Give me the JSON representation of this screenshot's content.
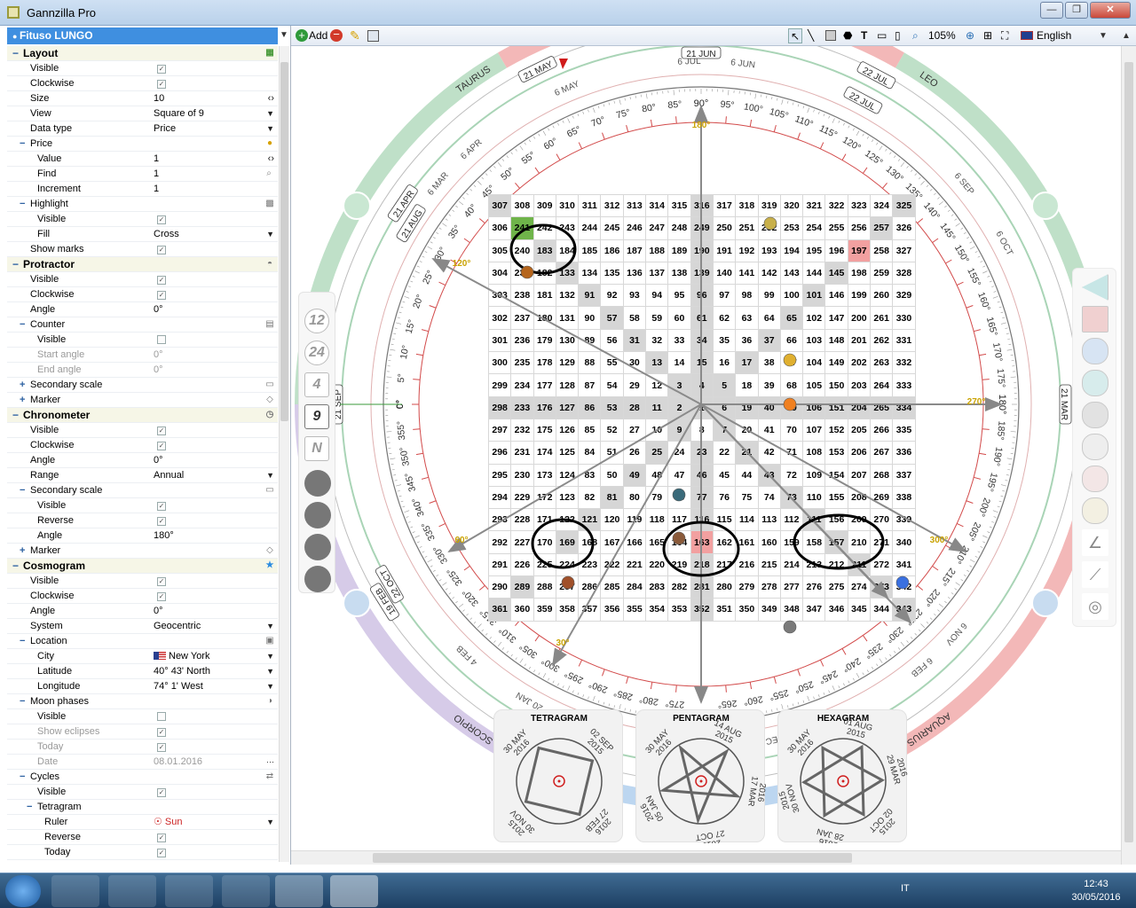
{
  "window": {
    "title": "Gannzilla Pro",
    "minimize": "—",
    "maximize": "❐",
    "close": "✕"
  },
  "profile": {
    "name": "Fituso LUNGO"
  },
  "properties": [
    {
      "kind": "cat",
      "label": "Layout",
      "toggle": "−",
      "icon": "grid-color-icon"
    },
    {
      "kind": "sub",
      "label": "Visible",
      "check": true
    },
    {
      "kind": "sub",
      "label": "Clockwise",
      "check": true
    },
    {
      "kind": "sub",
      "label": "Size",
      "value": "10",
      "spin": true
    },
    {
      "kind": "sub",
      "label": "View",
      "value": "Square of 9",
      "dd": true
    },
    {
      "kind": "sub",
      "label": "Data type",
      "value": "Price",
      "dd": true
    },
    {
      "kind": "sub",
      "label": "Price",
      "toggle": "−",
      "icon": "coin-icon"
    },
    {
      "kind": "sub2",
      "label": "Value",
      "value": "1",
      "spin": true
    },
    {
      "kind": "sub2",
      "label": "Find",
      "value": "1",
      "icon": "search-icon"
    },
    {
      "kind": "sub2",
      "label": "Increment",
      "value": "1"
    },
    {
      "kind": "sub",
      "label": "Highlight",
      "toggle": "−",
      "icon": "pattern-icon"
    },
    {
      "kind": "sub2",
      "label": "Visible",
      "check": true
    },
    {
      "kind": "sub2",
      "label": "Fill",
      "value": "Cross",
      "dd": true
    },
    {
      "kind": "sub",
      "label": "Show marks",
      "check": true
    },
    {
      "kind": "cat",
      "label": "Protractor",
      "toggle": "−",
      "icon": "protractor-icon"
    },
    {
      "kind": "sub",
      "label": "Visible",
      "check": true
    },
    {
      "kind": "sub",
      "label": "Clockwise",
      "check": true
    },
    {
      "kind": "sub",
      "label": "Angle",
      "value": "0°"
    },
    {
      "kind": "sub",
      "label": "Counter",
      "toggle": "−",
      "icon": "counter-icon"
    },
    {
      "kind": "sub2",
      "label": "Visible",
      "check": false
    },
    {
      "kind": "sub2",
      "label": "Start angle",
      "value": "0°",
      "dis": true
    },
    {
      "kind": "sub2",
      "label": "End angle",
      "value": "0°",
      "dis": true
    },
    {
      "kind": "sub",
      "label": "Secondary scale",
      "toggle": "+",
      "icon": "scale-icon"
    },
    {
      "kind": "sub",
      "label": "Marker",
      "toggle": "+",
      "icon": "marker-icon"
    },
    {
      "kind": "cat",
      "label": "Chronometer",
      "toggle": "−",
      "icon": "clock-icon"
    },
    {
      "kind": "sub",
      "label": "Visible",
      "check": true
    },
    {
      "kind": "sub",
      "label": "Clockwise",
      "check": true
    },
    {
      "kind": "sub",
      "label": "Angle",
      "value": "0°"
    },
    {
      "kind": "sub",
      "label": "Range",
      "value": "Annual",
      "dd": true
    },
    {
      "kind": "sub",
      "label": "Secondary scale",
      "toggle": "−",
      "icon": "scale-icon"
    },
    {
      "kind": "sub2",
      "label": "Visible",
      "check": true
    },
    {
      "kind": "sub2",
      "label": "Reverse",
      "check": true
    },
    {
      "kind": "sub2",
      "label": "Angle",
      "value": "180°"
    },
    {
      "kind": "sub",
      "label": "Marker",
      "toggle": "+",
      "icon": "marker-icon"
    },
    {
      "kind": "cat",
      "label": "Cosmogram",
      "toggle": "−",
      "icon": "star-icon"
    },
    {
      "kind": "sub",
      "label": "Visible",
      "check": true
    },
    {
      "kind": "sub",
      "label": "Clockwise",
      "check": true
    },
    {
      "kind": "sub",
      "label": "Angle",
      "value": "0°"
    },
    {
      "kind": "sub",
      "label": "System",
      "value": "Geocentric",
      "dd": true
    },
    {
      "kind": "sub",
      "label": "Location",
      "toggle": "−",
      "icon": "map-icon"
    },
    {
      "kind": "sub2",
      "label": "City",
      "value": "New York",
      "dd": true,
      "flag": "us"
    },
    {
      "kind": "sub2",
      "label": "Latitude",
      "value": "40°   43'   North",
      "dd": true
    },
    {
      "kind": "sub2",
      "label": "Longitude",
      "value": "74°   1'    West",
      "dd": true
    },
    {
      "kind": "sub",
      "label": "Moon phases",
      "toggle": "−",
      "icon": "moon-icon"
    },
    {
      "kind": "sub2",
      "label": "Visible",
      "check": false
    },
    {
      "kind": "sub2",
      "label": "Show eclipses",
      "check": true,
      "dis": true
    },
    {
      "kind": "sub2",
      "label": "Today",
      "check": true,
      "dis": true
    },
    {
      "kind": "sub2",
      "label": "Date",
      "value": "08.01.2016",
      "dis": true,
      "more": true
    },
    {
      "kind": "sub",
      "label": "Cycles",
      "toggle": "−",
      "icon": "cycle-icon"
    },
    {
      "kind": "sub2",
      "label": "Visible",
      "check": true
    },
    {
      "kind": "sub2",
      "label": "Tetragram",
      "toggle": "−"
    },
    {
      "kind": "sub3",
      "label": "Ruler",
      "value": "Sun",
      "dd": true,
      "sun": true
    },
    {
      "kind": "sub3",
      "label": "Reverse",
      "check": true
    },
    {
      "kind": "sub3",
      "label": "Today",
      "check": true
    }
  ],
  "toolbar": {
    "add": "Add",
    "zoom": "105%",
    "language": "English"
  },
  "grid": {
    "rows": [
      [
        307,
        308,
        309,
        310,
        311,
        312,
        313,
        314,
        315,
        316,
        317,
        318,
        319,
        320,
        321,
        322,
        323,
        324,
        325
      ],
      [
        306,
        241,
        242,
        243,
        244,
        245,
        246,
        247,
        248,
        249,
        250,
        251,
        252,
        253,
        254,
        255,
        256,
        257,
        326
      ],
      [
        305,
        240,
        183,
        184,
        185,
        186,
        187,
        188,
        189,
        190,
        191,
        192,
        193,
        194,
        195,
        196,
        197,
        258,
        327
      ],
      [
        304,
        239,
        182,
        133,
        134,
        135,
        136,
        137,
        138,
        139,
        140,
        141,
        142,
        143,
        144,
        145,
        198,
        259,
        328
      ],
      [
        303,
        238,
        181,
        132,
        91,
        92,
        93,
        94,
        95,
        96,
        97,
        98,
        99,
        100,
        101,
        146,
        199,
        260,
        329
      ],
      [
        302,
        237,
        180,
        131,
        90,
        57,
        58,
        59,
        60,
        61,
        62,
        63,
        64,
        65,
        102,
        147,
        200,
        261,
        330
      ],
      [
        301,
        236,
        179,
        130,
        89,
        56,
        31,
        32,
        33,
        34,
        35,
        36,
        37,
        66,
        103,
        148,
        201,
        262,
        331
      ],
      [
        300,
        235,
        178,
        129,
        88,
        55,
        30,
        13,
        14,
        15,
        16,
        17,
        38,
        67,
        104,
        149,
        202,
        263,
        332
      ],
      [
        299,
        234,
        177,
        128,
        87,
        54,
        29,
        12,
        3,
        4,
        5,
        18,
        39,
        68,
        105,
        150,
        203,
        264,
        333
      ],
      [
        298,
        233,
        176,
        127,
        86,
        53,
        28,
        11,
        2,
        1,
        6,
        19,
        40,
        69,
        106,
        151,
        204,
        265,
        334
      ],
      [
        297,
        232,
        175,
        126,
        85,
        52,
        27,
        10,
        9,
        8,
        7,
        20,
        41,
        70,
        107,
        152,
        205,
        266,
        335
      ],
      [
        296,
        231,
        174,
        125,
        84,
        51,
        26,
        25,
        24,
        23,
        22,
        21,
        42,
        71,
        108,
        153,
        206,
        267,
        336
      ],
      [
        295,
        230,
        173,
        124,
        83,
        50,
        49,
        48,
        47,
        46,
        45,
        44,
        43,
        72,
        109,
        154,
        207,
        268,
        337
      ],
      [
        294,
        229,
        172,
        123,
        82,
        81,
        80,
        79,
        78,
        77,
        76,
        75,
        74,
        73,
        110,
        155,
        208,
        269,
        338
      ],
      [
        293,
        228,
        171,
        122,
        121,
        120,
        119,
        118,
        117,
        116,
        115,
        114,
        113,
        112,
        111,
        156,
        209,
        270,
        339
      ],
      [
        292,
        227,
        170,
        169,
        168,
        167,
        166,
        165,
        164,
        163,
        162,
        161,
        160,
        159,
        158,
        157,
        210,
        271,
        340
      ],
      [
        291,
        226,
        225,
        224,
        223,
        222,
        221,
        220,
        219,
        218,
        217,
        216,
        215,
        214,
        213,
        212,
        211,
        272,
        341
      ],
      [
        290,
        289,
        288,
        287,
        286,
        285,
        284,
        283,
        282,
        281,
        280,
        279,
        278,
        277,
        276,
        275,
        274,
        273,
        342
      ],
      [
        361,
        360,
        359,
        358,
        357,
        356,
        355,
        354,
        353,
        352,
        351,
        350,
        349,
        348,
        347,
        346,
        345,
        344,
        343
      ]
    ]
  },
  "chart_labels": {
    "top": "90°",
    "right": "270°",
    "bottom": "180°",
    "left": "0°",
    "axis_180": "180°",
    "axis_270": "270°",
    "axis_120": "120°",
    "axis_60": "60°",
    "axis_30": "30°",
    "axis_300": "300°",
    "signs": [
      "TAURUS",
      "LEO",
      "AQUARIUS",
      "SCORPIO"
    ],
    "date_labels": [
      "21 JUN",
      "21 MAY",
      "21 APR",
      "21 SEP",
      "21 MAR",
      "22 OCT",
      "19 FEB",
      "22 JUL",
      "21 AUG",
      "22 JUL"
    ],
    "degree_labels": [
      "0°",
      "5°",
      "10°",
      "15°",
      "20°",
      "25°",
      "30°",
      "35°",
      "40°",
      "45°",
      "50°",
      "55°",
      "60°",
      "65°",
      "70°",
      "75°",
      "80°",
      "85°",
      "95°",
      "100°",
      "105°",
      "110°",
      "115°",
      "120°",
      "125°",
      "130°",
      "135°",
      "140°",
      "145°",
      "150°",
      "155°",
      "160°",
      "165°",
      "170°",
      "175°",
      "185°",
      "190°",
      "195°",
      "200°",
      "205°",
      "210°",
      "215°",
      "220°",
      "225°",
      "230°",
      "235°",
      "240°",
      "245°",
      "250°",
      "255°",
      "260°",
      "265°",
      "275°",
      "280°",
      "285°",
      "290°",
      "295°",
      "300°",
      "305°",
      "310°",
      "315°",
      "320°",
      "325°",
      "330°",
      "335°",
      "340°",
      "345°",
      "350°",
      "355°"
    ],
    "month_ticks": [
      "6 JUN",
      "6 JUL",
      "6 MAY",
      "6 AUG",
      "6 APR",
      "6 SEP",
      "6 MAR",
      "6 OCT",
      "6 FEB",
      "6 NOV",
      "20 JAN",
      "4 FEB",
      "20 NOV",
      "6 DEC"
    ]
  },
  "side_tools": [
    "12",
    "24",
    "4",
    "9",
    "N"
  ],
  "cycles": [
    {
      "title": "TETRAGRAM",
      "dates": [
        "2016",
        "30 MAY",
        "2015",
        "02 SEP",
        "27 FEB",
        "2016",
        "30 NOV",
        "2015"
      ]
    },
    {
      "title": "PENTAGRAM",
      "dates": [
        "2016",
        "30 MAY",
        "2015",
        "14 AUG",
        "17 MAR",
        "2016",
        "27 OCT",
        "2015",
        "05 JAN",
        "2016"
      ]
    },
    {
      "title": "HEXAGRAM",
      "dates": [
        "2016",
        "30 MAY",
        "2015",
        "01 AUG",
        "29 MAR",
        "2016",
        "02 OCT",
        "2015",
        "28 JAN",
        "2016",
        "30 NOV",
        "2015"
      ]
    }
  ],
  "taskbar": {
    "lang": "IT",
    "time": "12:43",
    "date": "30/05/2016"
  },
  "colors": {
    "accent": "#3f8fe0",
    "highlight_red": "#f2a0a0",
    "highlight_green": "#6fb44a",
    "cell_gray": "#d6d6d6",
    "ring_green": "#bfe0c8",
    "ring_red": "#f3b8b8",
    "ring_purple": "#d6cbe8",
    "ring_blue": "#bcd6f0"
  }
}
